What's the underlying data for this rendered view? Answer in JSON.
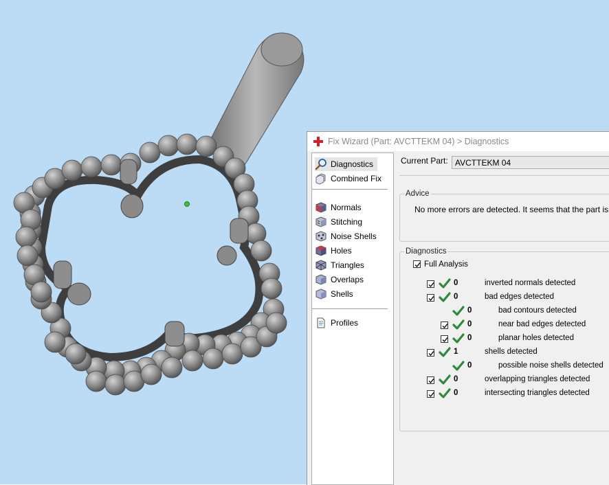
{
  "window": {
    "title": "Fix Wizard (Part: AVCTTEKM 04) > Diagnostics"
  },
  "nav": {
    "items": [
      {
        "label": "Diagnostics",
        "icon": "magnifier-icon",
        "selected": true
      },
      {
        "label": "Combined Fix",
        "icon": "combined-fix-icon"
      },
      {
        "label": "Normals",
        "icon": "normals-cube-icon"
      },
      {
        "label": "Stitching",
        "icon": "stitching-cube-icon"
      },
      {
        "label": "Noise Shells",
        "icon": "noise-shells-icon"
      },
      {
        "label": "Holes",
        "icon": "holes-cube-icon"
      },
      {
        "label": "Triangles",
        "icon": "triangles-cube-icon"
      },
      {
        "label": "Overlaps",
        "icon": "overlaps-cube-icon"
      },
      {
        "label": "Shells",
        "icon": "shells-cube-icon"
      },
      {
        "label": "Profiles",
        "icon": "profiles-document-icon"
      }
    ]
  },
  "current_part": {
    "label": "Current Part:",
    "value": "AVCTTEKM 04"
  },
  "advice": {
    "legend": "Advice",
    "text": "No more errors are detected. It seems that the part is ok."
  },
  "diagnostics": {
    "legend": "Diagnostics",
    "full_analysis_label": "Full Analysis",
    "full_analysis_checked": true,
    "rows": [
      {
        "count": "0",
        "label": "inverted normals detected",
        "indent": 0,
        "checkbox": true
      },
      {
        "count": "0",
        "label": "bad edges detected",
        "indent": 0,
        "checkbox": true
      },
      {
        "count": "0",
        "label": "bad contours detected",
        "indent": 1,
        "checkbox": false
      },
      {
        "count": "0",
        "label": "near bad edges detected",
        "indent": 1,
        "checkbox": true
      },
      {
        "count": "0",
        "label": "planar holes detected",
        "indent": 1,
        "checkbox": true
      },
      {
        "count": "1",
        "label": "shells detected",
        "indent": 0,
        "checkbox": true
      },
      {
        "count": "0",
        "label": "possible noise shells detected",
        "indent": 1,
        "checkbox": false
      },
      {
        "count": "0",
        "label": "overlapping triangles detected",
        "indent": 0,
        "checkbox": true
      },
      {
        "count": "0",
        "label": "intersecting triangles detected",
        "indent": 0,
        "checkbox": true
      }
    ]
  },
  "colors": {
    "viewport_bg": "#bcdcf6",
    "check_green": "#2e8a3a",
    "app_icon_red": "#d0202a"
  }
}
